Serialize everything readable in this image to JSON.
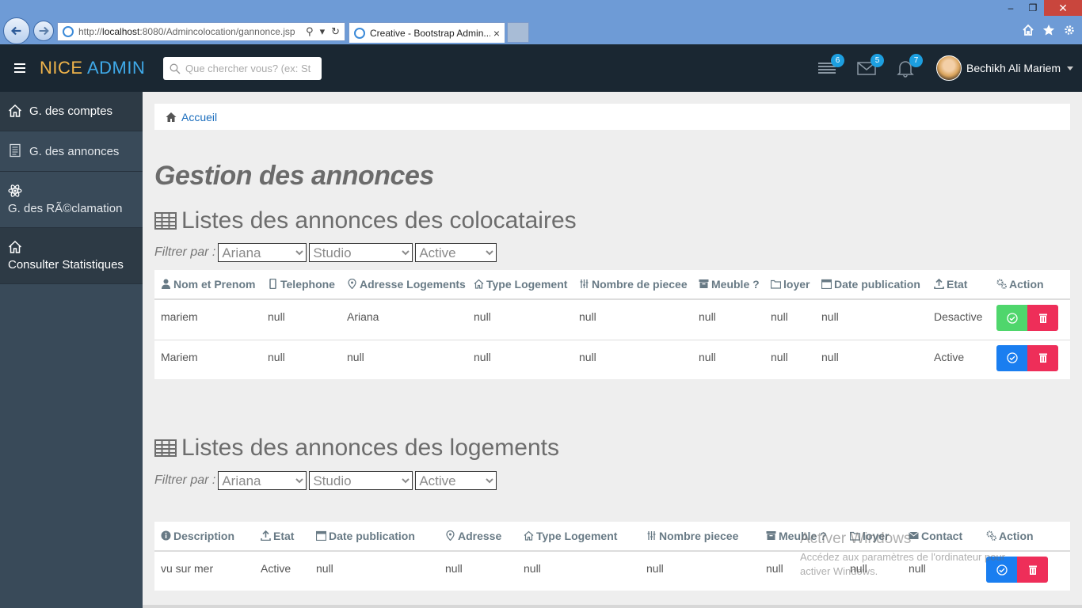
{
  "browser": {
    "url_prefix": "http://",
    "url_host": "localhost",
    "url_rest": ":8080/Admincolocation/gannonce.jsp",
    "tab_title": "Creative - Bootstrap Admin...",
    "tab_close": "×",
    "win_min": "–",
    "win_restore": "❐",
    "win_close": "✕"
  },
  "header": {
    "logo_part1": "NICE",
    "logo_part2": "ADMIN",
    "search_placeholder": "Que chercher vous? (ex: St",
    "tasks_badge": "6",
    "mail_badge": "5",
    "notif_badge": "7",
    "user_name": "Bechikh Ali Mariem"
  },
  "sidebar": {
    "items": [
      {
        "label": "G. des comptes",
        "icon": "home-icon"
      },
      {
        "label": "G. des annonces",
        "icon": "document-icon"
      },
      {
        "label": "G. des RÃ©clamation",
        "icon": "atom-icon"
      },
      {
        "label": "Consulter Statistiques",
        "icon": "home-icon"
      }
    ]
  },
  "breadcrumb": {
    "label": "Accueil"
  },
  "page_title": "Gestion des annonces",
  "section1": {
    "title": "Listes des annonces des colocataires",
    "filter_label": "Filtrer par :",
    "filter_values": [
      "Ariana",
      "Studio",
      "Active"
    ],
    "columns": [
      "Nom et Prenom",
      "Telephone",
      "Adresse Logements",
      "Type Logement",
      "Nombre de piecee",
      "Meuble ?",
      "loyer",
      "Date publication",
      "Etat",
      "Action"
    ],
    "rows": [
      [
        "mariem",
        "null",
        "Ariana",
        "null",
        "null",
        "null",
        "null",
        "null",
        "Desactive"
      ],
      [
        "Mariem",
        "null",
        "null",
        "null",
        "null",
        "null",
        "null",
        "null",
        "Active"
      ]
    ]
  },
  "section2": {
    "title": "Listes des annonces des logements",
    "filter_label": "Filtrer par :",
    "filter_values": [
      "Ariana",
      "Studio",
      "Active"
    ],
    "columns": [
      "Description",
      "Etat",
      "Date publication",
      "Adresse",
      "Type Logement",
      "Nombre piecee",
      "Meuble ?",
      "loyer",
      "Contact",
      "Action"
    ],
    "rows": [
      [
        "vu sur mer",
        "Active",
        "null",
        "null",
        "null",
        "null",
        "null",
        "null",
        "null"
      ]
    ]
  },
  "watermark": {
    "line1": "Activer Windows",
    "line2": "Accédez aux paramètres de l'ordinateur pour",
    "line3": "activer Windows."
  },
  "colors": {
    "header_bg": "#1a2732",
    "sidebar_bg": "#394a59",
    "logo_orange": "#f0b44b",
    "logo_blue": "#3fa9e8",
    "badge_blue": "#1d9fe0",
    "btn_green": "#4fd66c",
    "btn_blue": "#1a7ef0",
    "btn_red": "#ee2e59"
  }
}
